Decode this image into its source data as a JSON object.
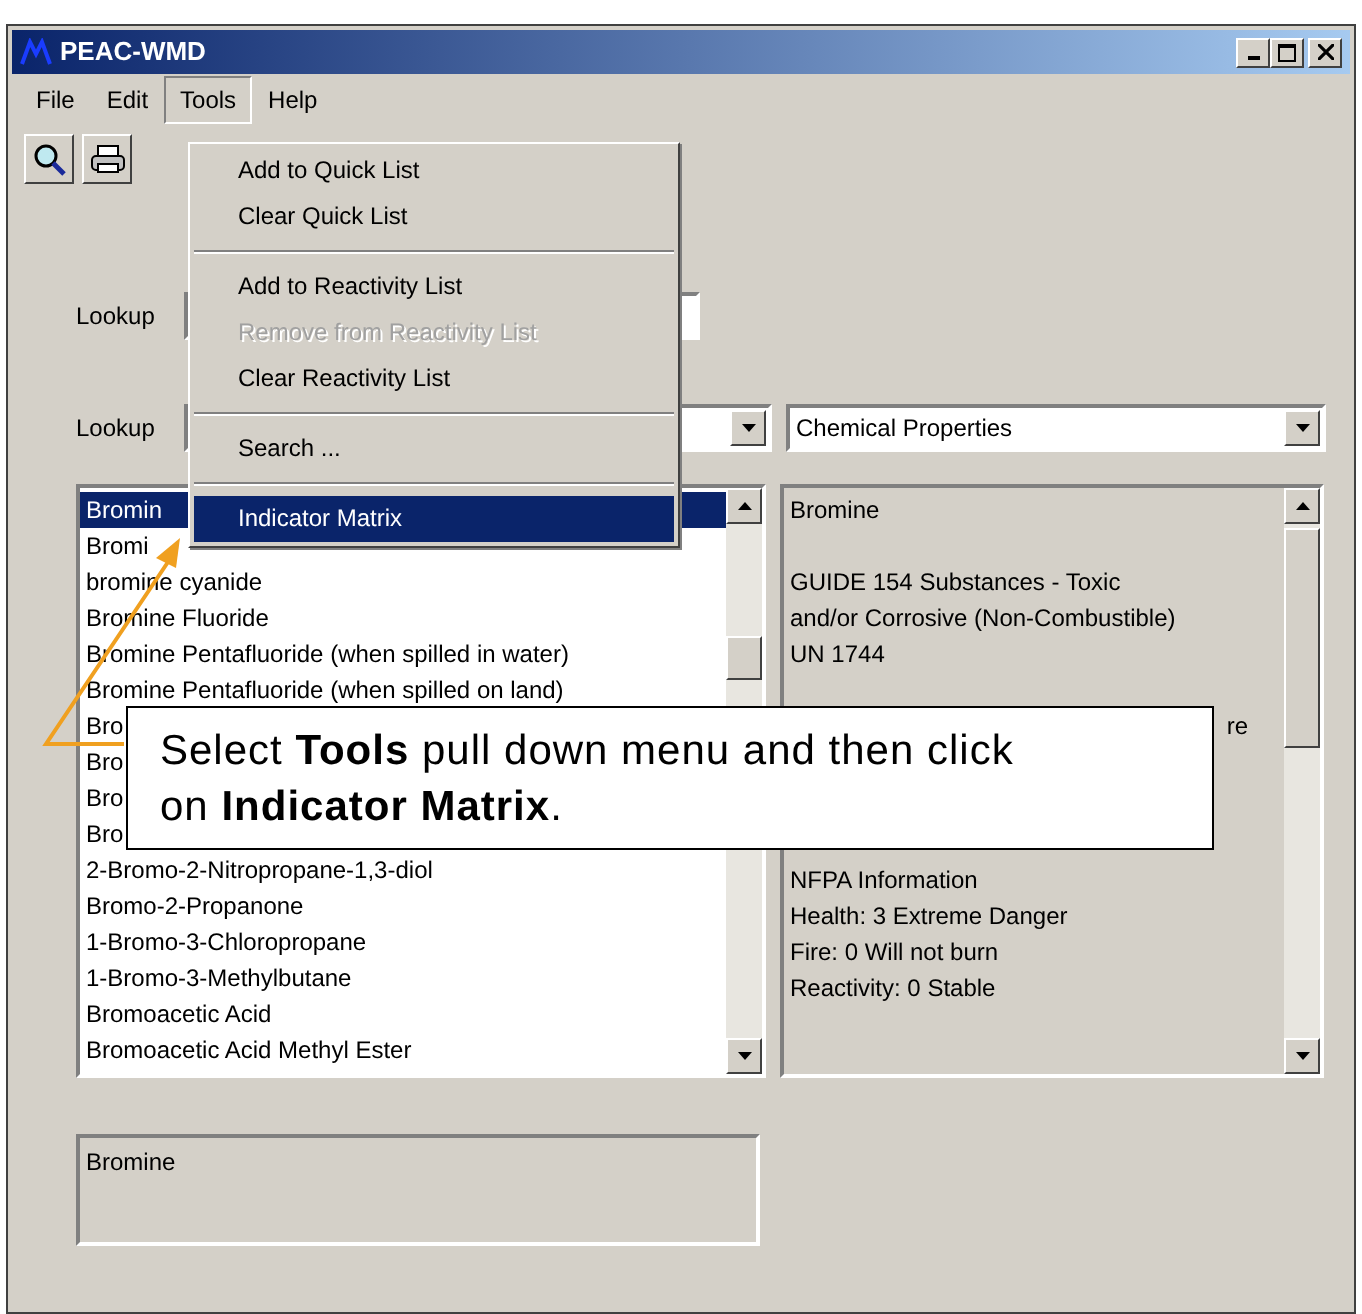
{
  "window": {
    "title": "PEAC-WMD"
  },
  "menu_bar": [
    {
      "label": "File",
      "selected": false
    },
    {
      "label": "Edit",
      "selected": false
    },
    {
      "label": "Tools",
      "selected": true
    },
    {
      "label": "Help",
      "selected": false
    }
  ],
  "lookup_rows": [
    {
      "label": "Lookup"
    },
    {
      "label": "Lookup"
    }
  ],
  "view_select": {
    "value": "Chemical Properties"
  },
  "substances": [
    {
      "name": "Bromin",
      "selected": true
    },
    {
      "name": "Bromi",
      "selected": false
    },
    {
      "name": "bromine cyanide",
      "selected": false
    },
    {
      "name": "Bromine Fluoride",
      "selected": false
    },
    {
      "name": "Bromine Pentafluoride (when spilled in water)",
      "selected": false
    },
    {
      "name": "Bromine Pentafluoride (when spilled on land)",
      "selected": false
    },
    {
      "name": "Bro",
      "selected": false
    },
    {
      "name": "Bro",
      "selected": false
    },
    {
      "name": "Bro",
      "selected": false
    },
    {
      "name": "Bro",
      "selected": false
    },
    {
      "name": "2-Bromo-2-Nitropropane-1,3-diol",
      "selected": false
    },
    {
      "name": "Bromo-2-Propanone",
      "selected": false
    },
    {
      "name": "1-Bromo-3-Chloropropane",
      "selected": false
    },
    {
      "name": "1-Bromo-3-Methylbutane",
      "selected": false
    },
    {
      "name": "Bromoacetic Acid",
      "selected": false
    },
    {
      "name": "Bromoacetic Acid Methyl Ester",
      "selected": false
    }
  ],
  "properties": [
    {
      "kind": "text",
      "lines": [
        "Bromine"
      ]
    },
    {
      "kind": "text",
      "lines": [
        "GUIDE 154 Substances - Toxic",
        "and/or Corrosive (Non-Combustible)",
        "UN 1744"
      ]
    },
    {
      "kind": "fragment",
      "lines": [
        "re"
      ]
    },
    {
      "kind": "text",
      "lines": [
        "NFPA Information",
        "Health: 3 Extreme Danger",
        "Fire: 0 Will not burn",
        "Reactivity: 0 Stable"
      ]
    }
  ],
  "name_box": {
    "value": "Bromine"
  },
  "tools_menu": {
    "items": [
      {
        "kind": "item",
        "label": "Add to Quick List",
        "disabled": false,
        "selected": false
      },
      {
        "kind": "item",
        "label": "Clear Quick List",
        "disabled": false,
        "selected": false
      },
      {
        "kind": "separator"
      },
      {
        "kind": "item",
        "label": "Add to Reactivity List",
        "disabled": false,
        "selected": false
      },
      {
        "kind": "item",
        "label": "Remove from Reactivity List",
        "disabled": true,
        "selected": false
      },
      {
        "kind": "item",
        "label": "Clear Reactivity List",
        "disabled": false,
        "selected": false
      },
      {
        "kind": "separator"
      },
      {
        "kind": "item",
        "label": "Search ...",
        "disabled": false,
        "selected": false
      },
      {
        "kind": "separator"
      },
      {
        "kind": "item",
        "label": "Indicator Matrix",
        "disabled": false,
        "selected": true
      }
    ]
  },
  "callout": {
    "lines": [
      "Select **Tools** pull down menu and then click",
      "on **Indicator Matrix**."
    ]
  }
}
